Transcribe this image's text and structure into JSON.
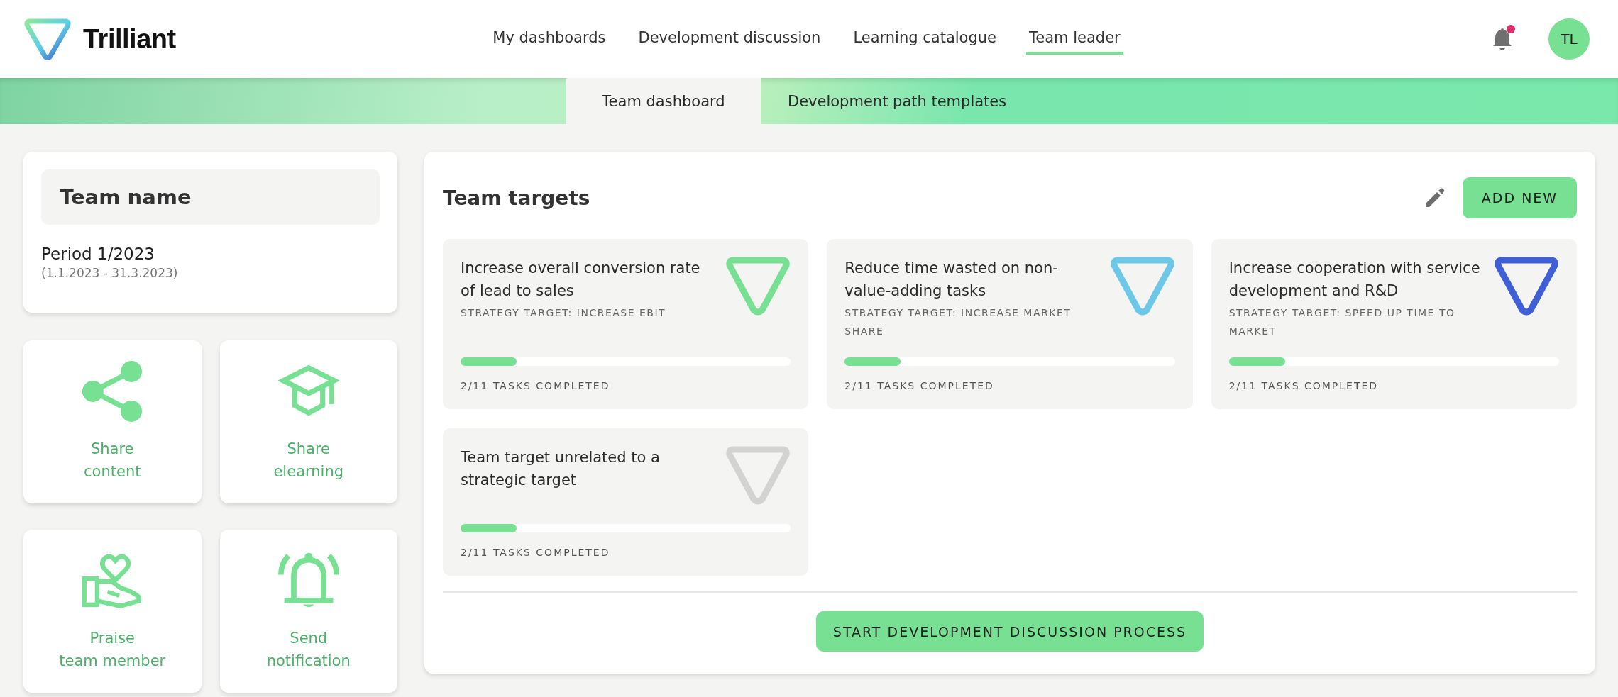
{
  "header": {
    "logo": "Trilliant",
    "nav": [
      {
        "label": "My dashboards",
        "selected": false
      },
      {
        "label": "Development discussion",
        "selected": false
      },
      {
        "label": "Learning catalogue",
        "selected": false
      },
      {
        "label": "Team leader",
        "selected": true
      }
    ],
    "notifications_unread": true,
    "avatar": "TL"
  },
  "subtabs": [
    {
      "label": "Team dashboard",
      "selected": true
    },
    {
      "label": "Development path templates",
      "selected": false
    }
  ],
  "team": {
    "name": "Team name",
    "period": "Period 1/2023",
    "dates": "(1.1.2023 - 31.3.2023)"
  },
  "actions": [
    {
      "kind": "share",
      "label": "Share\ncontent"
    },
    {
      "kind": "elearning",
      "label": "Share\nelearning"
    },
    {
      "kind": "praise",
      "label": "Praise\nteam member"
    },
    {
      "kind": "notify",
      "label": "Send\nnotification"
    }
  ],
  "targets": {
    "title": "Team targets",
    "add_button": "ADD NEW",
    "items": [
      {
        "title": "Increase overall conversion rate of lead to sales",
        "strategy": "STRATEGY TARGET: INCREASE EBIT",
        "color": "#77e092",
        "level": 0.17,
        "progress": "2/11 TASKS COMPLETED"
      },
      {
        "title": "Reduce time wasted on non-value-adding tasks",
        "strategy": "STRATEGY TARGET: INCREASE MARKET SHARE",
        "color": "#6cc8e6",
        "level": 0.17,
        "progress": "2/11 TASKS COMPLETED"
      },
      {
        "title": "Increase cooperation with service development and R&D",
        "strategy": "STRATEGY TARGET: SPEED UP TIME TO MARKET",
        "color": "#3f5fd6",
        "level": 0.17,
        "progress": "2/11 TASKS COMPLETED"
      },
      {
        "title": "Team target unrelated to a strategic target",
        "color": "#d3d3d1",
        "level": 0.17,
        "progress": "2/11 TASKS COMPLETED"
      }
    ],
    "start_button": "START DEVELOPMENT DISCUSSION PROCESS"
  }
}
